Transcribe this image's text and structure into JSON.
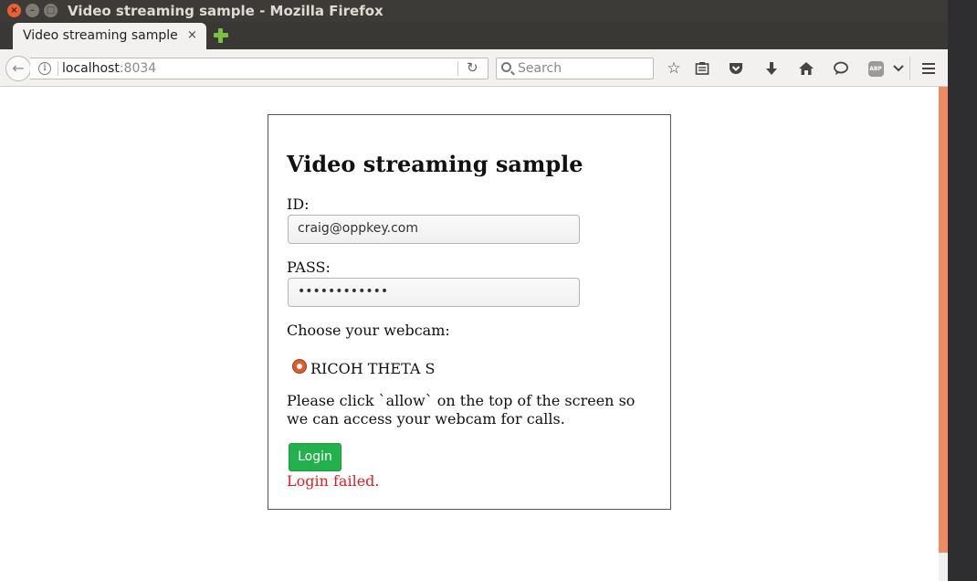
{
  "window": {
    "title": "Video streaming sample - Mozilla Firefox",
    "buttons": {
      "close": "×",
      "minimize": "–",
      "maximize": "□"
    }
  },
  "tab": {
    "label": "Video streaming sample",
    "close": "×"
  },
  "navbar": {
    "url_host": "localhost",
    "url_port": ":8034",
    "search_placeholder": "Search",
    "back_glyph": "←",
    "reload_glyph": "↻",
    "abp_text": "ABP",
    "icons": [
      "back-icon",
      "info-icon",
      "reload-icon",
      "search-icon",
      "star-icon",
      "reader-list-icon",
      "pocket-icon",
      "download-icon",
      "home-icon",
      "chat-icon",
      "adblock-icon",
      "chevron-down-icon",
      "menu-icon"
    ]
  },
  "page": {
    "heading": "Video streaming sample",
    "id_label": "ID:",
    "id_value": "craig@oppkey.com",
    "pass_label": "PASS:",
    "pass_value": "••••••••••••",
    "webcam_label": "Choose your webcam:",
    "webcam_option": "RICOH THETA S",
    "info_text": "Please click `allow` on the top of the screen so we can access your webcam for calls.",
    "login_button": "Login",
    "error_text": "Login failed."
  },
  "colors": {
    "login_button": "#22b14c",
    "error_text": "#e02020",
    "radio_selected": "#e05b2e",
    "scrollbar": "#ee8a63"
  }
}
